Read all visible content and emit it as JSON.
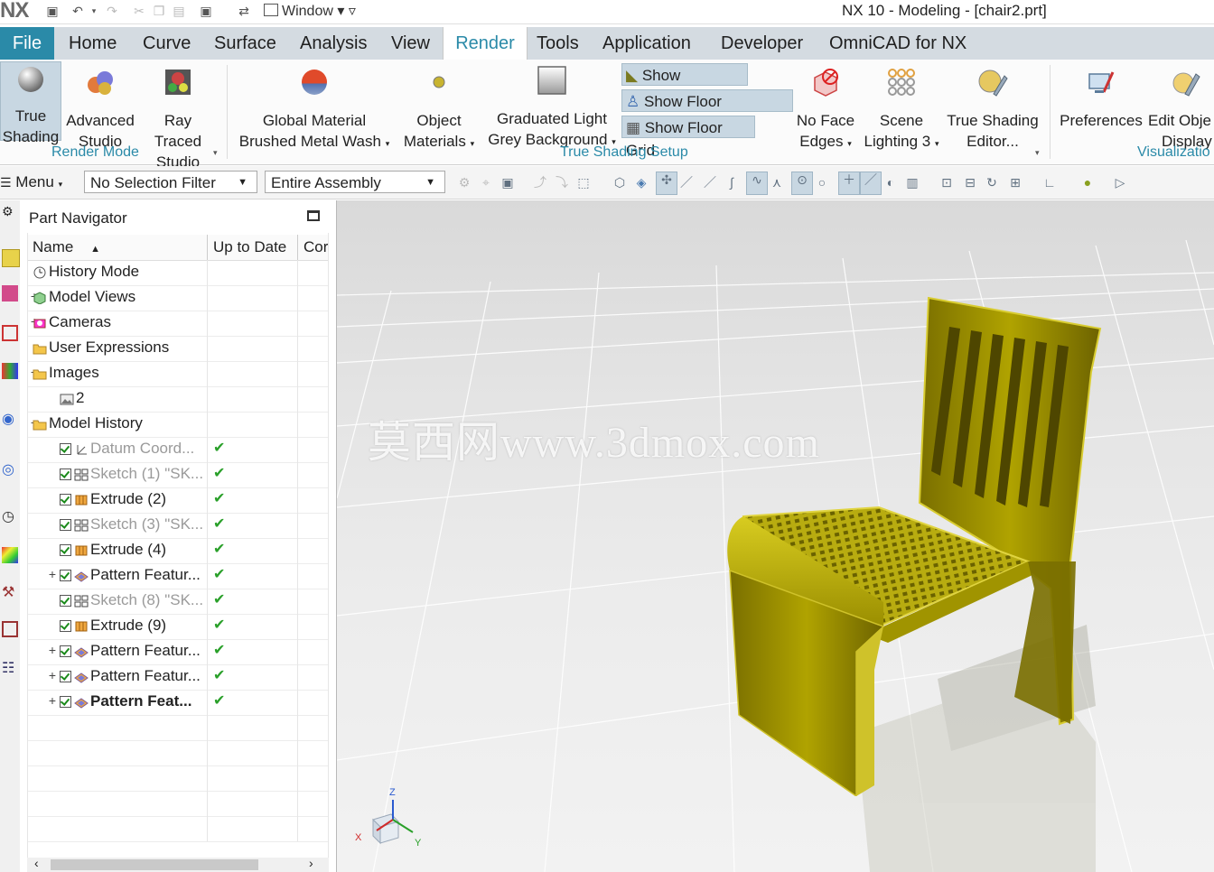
{
  "titlebar": {
    "logo": "NX",
    "window_menu": "Window",
    "app_title": "NX 10 - Modeling - [chair2.prt]"
  },
  "tabs": [
    {
      "label": "File"
    },
    {
      "label": "Home"
    },
    {
      "label": "Curve"
    },
    {
      "label": "Surface"
    },
    {
      "label": "Analysis"
    },
    {
      "label": "View"
    },
    {
      "label": "Render"
    },
    {
      "label": "Tools"
    },
    {
      "label": "Application"
    },
    {
      "label": "Developer"
    },
    {
      "label": "OmniCAD for NX"
    }
  ],
  "active_tab": "Render",
  "ribbon": {
    "true_shading": {
      "line1": "True",
      "line2": "Shading"
    },
    "advanced_studio": {
      "line1": "Advanced",
      "line2": "Studio"
    },
    "ray_traced_studio": {
      "line1": "Ray Traced",
      "line2": "Studio"
    },
    "render_mode_group": "Render Mode",
    "global_material": {
      "line1": "Global Material",
      "line2": "Brushed Metal Wash"
    },
    "object_materials": {
      "line1": "Object",
      "line2": "Materials"
    },
    "graduated_light": {
      "line1": "Graduated Light",
      "line2": "Grey Background"
    },
    "show_shadows": "Show Shadows",
    "show_floor_reflection": "Show Floor Reflection",
    "show_floor_grid": "Show Floor Grid",
    "no_face_edges": {
      "line1": "No Face",
      "line2": "Edges"
    },
    "scene_lighting": {
      "line1": "Scene",
      "line2": "Lighting 3"
    },
    "true_shading_editor": {
      "line1": "True Shading",
      "line2": "Editor..."
    },
    "true_shading_setup_group": "True Shading Setup",
    "preferences": "Preferences",
    "edit_object_display": {
      "line1": "Edit Obje",
      "line2": "Display"
    },
    "visualization_group": "Visualizatio"
  },
  "selbar": {
    "menu": "Menu",
    "selection_filter": "No Selection Filter",
    "scope": "Entire Assembly"
  },
  "navigator": {
    "title": "Part Navigator",
    "columns": {
      "name": "Name",
      "up_to_date": "Up to Date",
      "comment": "Cor"
    },
    "rows": [
      {
        "label": "History Mode",
        "indent": 0,
        "expander": "",
        "check": false,
        "dim": false,
        "bold": false,
        "uptodate": ""
      },
      {
        "label": "Model Views",
        "indent": 0,
        "expander": "+",
        "check": false,
        "dim": false,
        "bold": false,
        "uptodate": ""
      },
      {
        "label": "Cameras",
        "indent": 0,
        "expander": "+",
        "check": false,
        "dim": false,
        "bold": false,
        "uptodate": ""
      },
      {
        "label": "User Expressions",
        "indent": 0,
        "expander": "",
        "check": false,
        "dim": false,
        "bold": false,
        "uptodate": ""
      },
      {
        "label": "Images",
        "indent": 0,
        "expander": "−",
        "check": false,
        "dim": false,
        "bold": false,
        "uptodate": ""
      },
      {
        "label": "2",
        "indent": 1,
        "expander": "",
        "check": false,
        "dim": false,
        "bold": false,
        "uptodate": ""
      },
      {
        "label": "Model History",
        "indent": 0,
        "expander": "−",
        "check": false,
        "dim": false,
        "bold": false,
        "uptodate": ""
      },
      {
        "label": "Datum Coord...",
        "indent": 1,
        "expander": "",
        "check": true,
        "dim": true,
        "bold": false,
        "uptodate": "✔"
      },
      {
        "label": "Sketch (1) \"SK...",
        "indent": 1,
        "expander": "",
        "check": true,
        "dim": true,
        "bold": false,
        "uptodate": "✔"
      },
      {
        "label": "Extrude (2)",
        "indent": 1,
        "expander": "",
        "check": true,
        "dim": false,
        "bold": false,
        "uptodate": "✔"
      },
      {
        "label": "Sketch (3) \"SK...",
        "indent": 1,
        "expander": "",
        "check": true,
        "dim": true,
        "bold": false,
        "uptodate": "✔"
      },
      {
        "label": "Extrude (4)",
        "indent": 1,
        "expander": "",
        "check": true,
        "dim": false,
        "bold": false,
        "uptodate": "✔"
      },
      {
        "label": "Pattern Featur...",
        "indent": 1,
        "expander": "+",
        "check": true,
        "dim": false,
        "bold": false,
        "uptodate": "✔"
      },
      {
        "label": "Sketch (8) \"SK...",
        "indent": 1,
        "expander": "",
        "check": true,
        "dim": true,
        "bold": false,
        "uptodate": "✔"
      },
      {
        "label": "Extrude (9)",
        "indent": 1,
        "expander": "",
        "check": true,
        "dim": false,
        "bold": false,
        "uptodate": "✔"
      },
      {
        "label": "Pattern Featur...",
        "indent": 1,
        "expander": "+",
        "check": true,
        "dim": false,
        "bold": false,
        "uptodate": "✔"
      },
      {
        "label": "Pattern Featur...",
        "indent": 1,
        "expander": "+",
        "check": true,
        "dim": false,
        "bold": false,
        "uptodate": "✔"
      },
      {
        "label": "Pattern Feat...",
        "indent": 1,
        "expander": "+",
        "check": true,
        "dim": false,
        "bold": true,
        "uptodate": "✔"
      }
    ]
  },
  "viewport": {
    "watermark": "莫西网www.3dmox.com",
    "triad": {
      "z": "Z",
      "x": "X",
      "y": "Y"
    },
    "model_color": "#a79a00"
  }
}
